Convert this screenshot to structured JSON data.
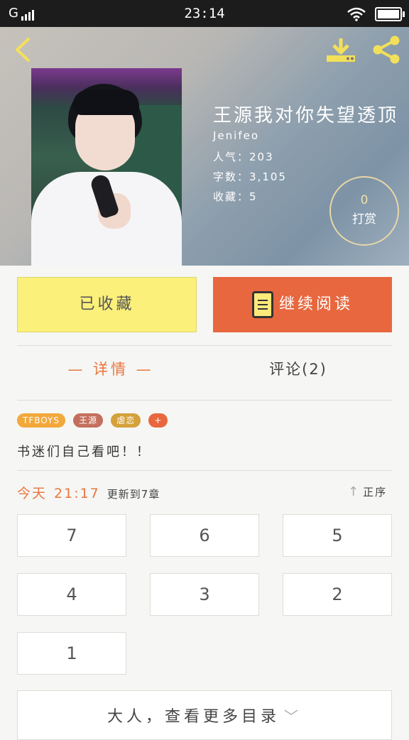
{
  "status_bar": {
    "carrier": "G",
    "time": "23:14"
  },
  "book": {
    "title": "王源我对你失望透顶",
    "author": "Jenifeo",
    "popularity_label": "人气：",
    "popularity": "203",
    "words_label": "字数：",
    "words": "3,105",
    "favorites_label": "收藏：",
    "favorites": "5",
    "tip_count": "0",
    "tip_label": "打赏"
  },
  "actions": {
    "collected_label": "已收藏",
    "continue_label": "继续阅读"
  },
  "tabs": {
    "detail": "— 详情 —",
    "comments": "评论(2)"
  },
  "tags": [
    {
      "label": "TFBOYS",
      "color": "#f2a83a"
    },
    {
      "label": "王源",
      "color": "#c46f5e"
    },
    {
      "label": "虐恋",
      "color": "#d4a13a"
    },
    {
      "label": "+",
      "color": "#e8673e"
    }
  ],
  "synopsis": "书迷们自己看吧！！",
  "update": {
    "day": "今天",
    "time": "21:17",
    "note": "更新到7章"
  },
  "sort_label": "正序",
  "chapters": [
    "7",
    "6",
    "5",
    "4",
    "3",
    "2",
    "1"
  ],
  "more_label": "大人，查看更多目录",
  "icons": [
    "back-icon",
    "download-icon",
    "share-icon",
    "book-icon",
    "sort-up-icon",
    "chevron-down-icon"
  ],
  "colors": {
    "accent": "#e8673e",
    "collected_bg": "#fbf07a",
    "tab_active": "#e8763f"
  }
}
